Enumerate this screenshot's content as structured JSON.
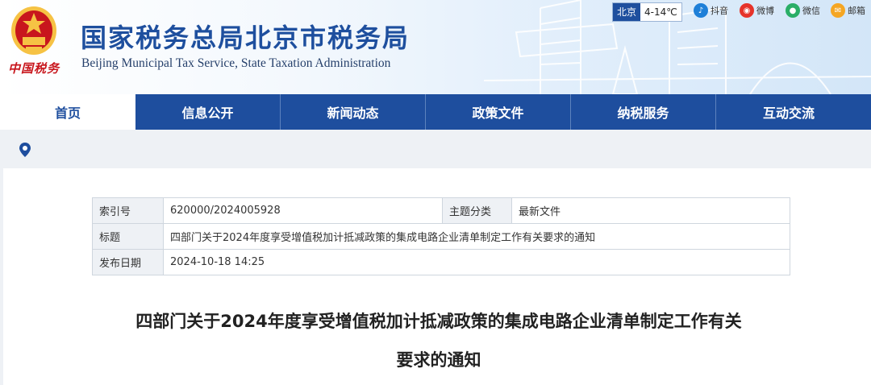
{
  "header": {
    "emblem_text": "中国税务",
    "title": "国家税务总局北京市税务局",
    "subtitle": "Beijing Municipal Tax Service, State Taxation Administration",
    "weather": {
      "city": "北京",
      "temp": "4-14℃"
    },
    "social": [
      {
        "label": "抖音",
        "color": "#1e7fd8",
        "icon": "douyin-icon"
      },
      {
        "label": "微博",
        "color": "#e6332a",
        "icon": "weibo-icon"
      },
      {
        "label": "微信",
        "color": "#2aae67",
        "icon": "wechat-icon"
      },
      {
        "label": "邮箱",
        "color": "#f5a623",
        "icon": "mail-icon"
      }
    ]
  },
  "nav": {
    "items": [
      {
        "label": "首页",
        "active": true
      },
      {
        "label": "信息公开"
      },
      {
        "label": "新闻动态"
      },
      {
        "label": "政策文件"
      },
      {
        "label": "纳税服务"
      },
      {
        "label": "互动交流"
      }
    ]
  },
  "breadcrumb": {
    "icon": "location-pin-icon",
    "color": "#1e4e9e"
  },
  "meta": {
    "index_label": "索引号",
    "index_value": "620000/2024005928",
    "category_label": "主题分类",
    "category_value": "最新文件",
    "title_label": "标题",
    "title_value": "四部门关于2024年度享受增值税加计抵减政策的集成电路企业清单制定工作有关要求的通知",
    "date_label": "发布日期",
    "date_value": "2024-10-18 14:25"
  },
  "article": {
    "title_line1": "四部门关于2024年度享受增值税加计抵减政策的集成电路企业清单制定工作有关",
    "title_line2": "要求的通知"
  },
  "colors": {
    "brand_blue": "#1e4e9e",
    "title_blue": "#1e4f9e",
    "emblem_red": "#c8161d"
  }
}
